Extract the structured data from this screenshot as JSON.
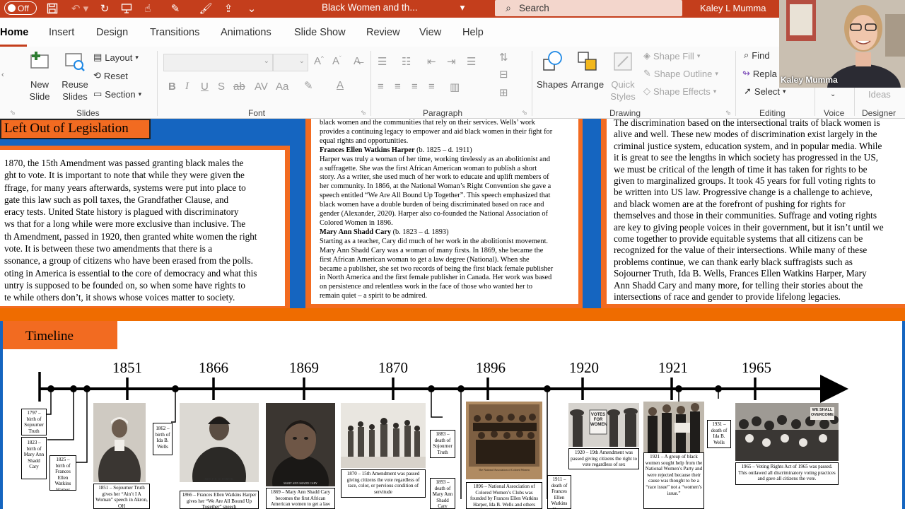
{
  "app": {
    "autosave_label": "Off",
    "document_title": "Black Women and th...",
    "search_placeholder": "Search",
    "user_name": "Kaley L Mumma",
    "webcam_name": "Kaley Mumma"
  },
  "ribbon": {
    "tabs": [
      "Home",
      "Insert",
      "Design",
      "Transitions",
      "Animations",
      "Slide Show",
      "Review",
      "View",
      "Help"
    ],
    "active_tab": "Home",
    "groups": {
      "slides": "Slides",
      "font": "Font",
      "paragraph": "Paragraph",
      "drawing": "Drawing",
      "editing": "Editing",
      "voice": "Voice",
      "designer": "Designer"
    },
    "buttons": {
      "new_slide": "New Slide",
      "reuse_slides": "Reuse Slides",
      "layout": "Layout",
      "reset": "Reset",
      "section": "Section",
      "shapes": "Shapes",
      "arrange": "Arrange",
      "quick_styles": "Quick Styles",
      "shape_fill": "Shape Fill",
      "shape_outline": "Shape Outline",
      "shape_effects": "Shape Effects",
      "find": "Find",
      "replace": "Repla",
      "select": "Select",
      "ideas": "Ideas"
    }
  },
  "slide": {
    "legislation": {
      "heading": "Left Out of Legislation",
      "lines": [
        "1870, the 15th Amendment was passed granting black males the",
        "ght to vote. It is important to note that while they were given the",
        "ffrage, for many years afterwards, systems were put into place to",
        "gate this law such as poll taxes, the Grandfather Clause, and",
        "eracy tests. United State history is plagued with discriminatory",
        "ws that for a long while were more exclusive than inclusive. The",
        "th Amendment, passed in 1920, then granted white women the right",
        "vote. It is between these two amendments that there is a",
        "ssonance, a group of citizens who have been erased from the polls.",
        "oting in America is essential to the core of democracy and what this",
        "untry is supposed to be founded on, so when some have rights to",
        "te while others don’t, it shows whose voices matter to society."
      ]
    },
    "activists": {
      "intro_lines": [
        "black women and the communities that rely on their services. Wells’ work",
        "provides a continuing legacy to empower and aid black women in their fight for",
        "equal rights and opportunities."
      ],
      "harper_name": "Frances Ellen Watkins Harper",
      "harper_dates": " (b. 1825 – d. 1911)",
      "harper_lines": [
        "Harper was truly a woman of her time, working tirelessly as an abolitionist and",
        "a suffragette. She was the first African American woman to publish a short",
        "story. As a writer, she used much of her work to educate and uplift members of",
        "her community. In 1866, at the National Woman’s Right Convention she gave a",
        "speech entitled “We Are All Bound Up Together”. This speech emphasized that",
        "black women have a double burden of being discriminated based on race and",
        "gender (Alexander, 2020). Harper also co-founded the National Association of",
        "Colored Women in 1896."
      ],
      "cary_name": "Mary Ann Shadd Cary",
      "cary_dates": " (b. 1823 – d. 1893)",
      "cary_lines": [
        "Starting as a teacher, Cary did much of her work in the abolitionist movement.",
        "Mary Ann Shadd Cary was a woman of many firsts. In 1869, she became the",
        "first African American woman to get a law degree (National). When she",
        "became a publisher, she set two records of being the first black female publisher",
        "in North America and the first female publisher in Canada. Her work was based",
        "on persistence and relentless work in the face of those who wanted her to",
        "remain quiet – a spirit to be admired."
      ]
    },
    "conclusion": {
      "lines": [
        "The discrimination based on the intersectional traits of black women is",
        "alive and well. These new modes of discrimination exist largely in the",
        "criminal justice system, education system, and in popular media. While",
        "it is great to see the lengths in which society has progressed in the US,",
        "we must be critical of the length of time it has taken for rights to be",
        "given to marginalized groups. It took 45 years for full voting rights to",
        "be written into US law. Progressive change is a challenge to achieve,",
        "and black women are at the forefront of pushing for rights for",
        "themselves and those in their communities. Suffrage and voting rights",
        "are key to giving people voices in their government, but it isn’t until we",
        "come together to provide equitable systems that all citizens can be",
        "recognized for the value of their intersections. While many of these",
        "problems continue, we can thank early black suffragists such as",
        "Sojourner Truth, Ida B. Wells, Frances Ellen Watkins Harper, Mary",
        "Ann Shadd Cary and many more, for telling their stories about the",
        "intersections of race and gender to provide lifelong legacies."
      ]
    },
    "timeline": {
      "heading": "Timeline",
      "years": [
        "1851",
        "1866",
        "1869",
        "1870",
        "1896",
        "1920",
        "1921",
        "1965"
      ],
      "events": {
        "truth_birth": "1797 – birth of Sojourner Truth",
        "cary_birth": "1823 – birth of Mary Ann Shadd Cary",
        "harper_birth": "1825 – birth of Frances Ellen Watkins Harper",
        "truth_speech": "1851 – Sojourner Truth gives her “Ain’t I A Woman” speech in Akron, OH",
        "wells_birth": "1862 – birth of Ida B. Wells",
        "harper_speech": "1866 – Frances Ellen Watkins Harper gives her “We Are All Bound Up Together” speech",
        "cary_law": "1869 – Mary Ann Shadd Cary becomes the first African American women to get a law degree",
        "amend15": "1870 – 15th Amendment was passed giving citizens the vote regardless of race, color, or pervious condition of servitude",
        "truth_death": "1883 – death of Sojourner Truth",
        "cary_death": "1893 – death of Mary Ann Shadd Cary",
        "nacw": "1896 – National Association of Colored Women’s Clubs was founded by Frances Ellen Watkins Harper, Ida B. Wells and others",
        "harper_death": "1911 – death of Frances Ellen Watkins Harper",
        "amend19": "1920 – 19th Amendment was passed giving citizens the right to vote regardless of sex",
        "nwp": "1921 – A group of black women sought help from the National Women’s Party and were rejected because their cause was thought to be a “race issue” not a “women’s issue.”",
        "wells_death": "1931 – death of Ida B. Wells",
        "vra": "1965 – Voting Rights Act of 1965 was passed. This outlawed all discriminatory voting practices and gave all citizens the vote."
      },
      "photo_text": {
        "votes_sign": "VOTES FOR WOMEN",
        "march_sign": "WE SHALL OVERCOME",
        "harper_caption": "MRS. F. E. W. HARPER.",
        "cary_caption": "MARY ANN SHADD CARY",
        "nacw_caption": "The National Association of Colored Women"
      }
    }
  },
  "colors": {
    "accent": "#c43e1c",
    "slide_blue": "#1565c0",
    "slide_orange": "#f26b21"
  }
}
